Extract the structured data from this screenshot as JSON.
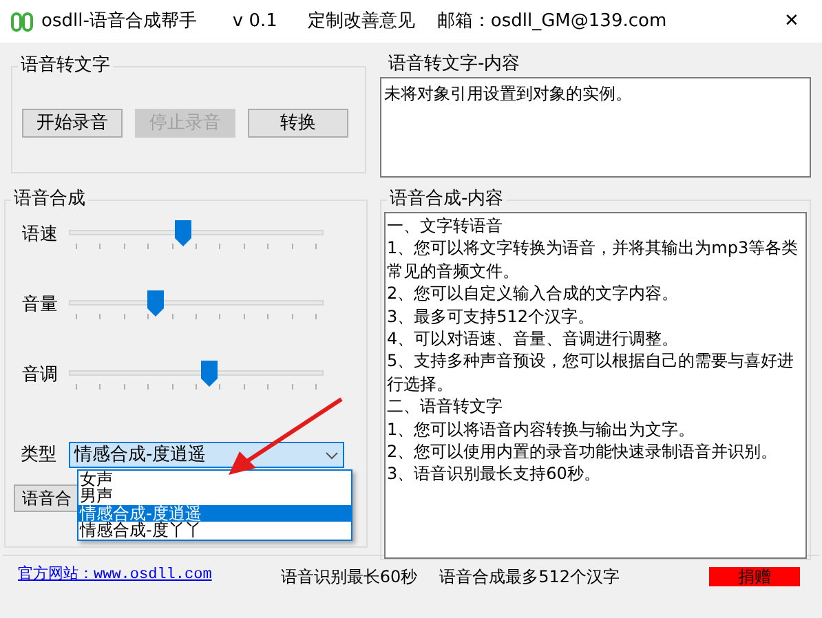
{
  "window": {
    "title": "osdll-语音合成帮手",
    "version": "v 0.1",
    "feedback": "定制改善意见",
    "email": "邮箱：osdll_GM@139.com",
    "close": "✕"
  },
  "stt": {
    "title": "语音转文字",
    "buttons": [
      {
        "label": "开始录音",
        "disabled": false
      },
      {
        "label": "停止录音",
        "disabled": true
      },
      {
        "label": "转换",
        "disabled": false
      }
    ]
  },
  "stt_content": {
    "title": "语音转文字-内容",
    "text": "未将对象引用设置到对象的实例。"
  },
  "tts": {
    "title": "语音合成",
    "sliders": [
      {
        "label": "语速",
        "level": 0.45
      },
      {
        "label": "音量",
        "level": 0.34
      },
      {
        "label": "音调",
        "level": 0.55
      }
    ],
    "type_label": "类型",
    "type_value": "情感合成-度逍遥",
    "type_options": [
      {
        "label": "女声",
        "selected": false
      },
      {
        "label": "男声",
        "selected": false
      },
      {
        "label": "情感合成-度逍遥",
        "selected": true
      },
      {
        "label": "情感合成-度丫丫",
        "selected": false
      }
    ],
    "synth_button": "语音合"
  },
  "tts_content": {
    "title": "语音合成-内容",
    "lines": [
      "一、文字转语音",
      "1、您可以将文字转换为语音，并将其输出为mp3等各类常见的音频文件。",
      "2、您可以自定义输入合成的文字内容。",
      "3、最多可支持512个汉字。",
      "4、可以对语速、音量、音调进行调整。",
      "5、支持多种声音预设，您可以根据自己的需要与喜好进行选择。",
      "二、语音转文字",
      "1、您可以将语音内容转换与输出为文字。",
      "2、您可以使用内置的录音功能快速录制语音并识别。",
      "3、语音识别最长支持60秒。"
    ]
  },
  "status_bar": {
    "link": "官方网站：www.osdll.com",
    "stt_limit": "语音识别最长60秒",
    "tts_limit": "语音合成最多512个汉字",
    "donate": "捐赠"
  }
}
